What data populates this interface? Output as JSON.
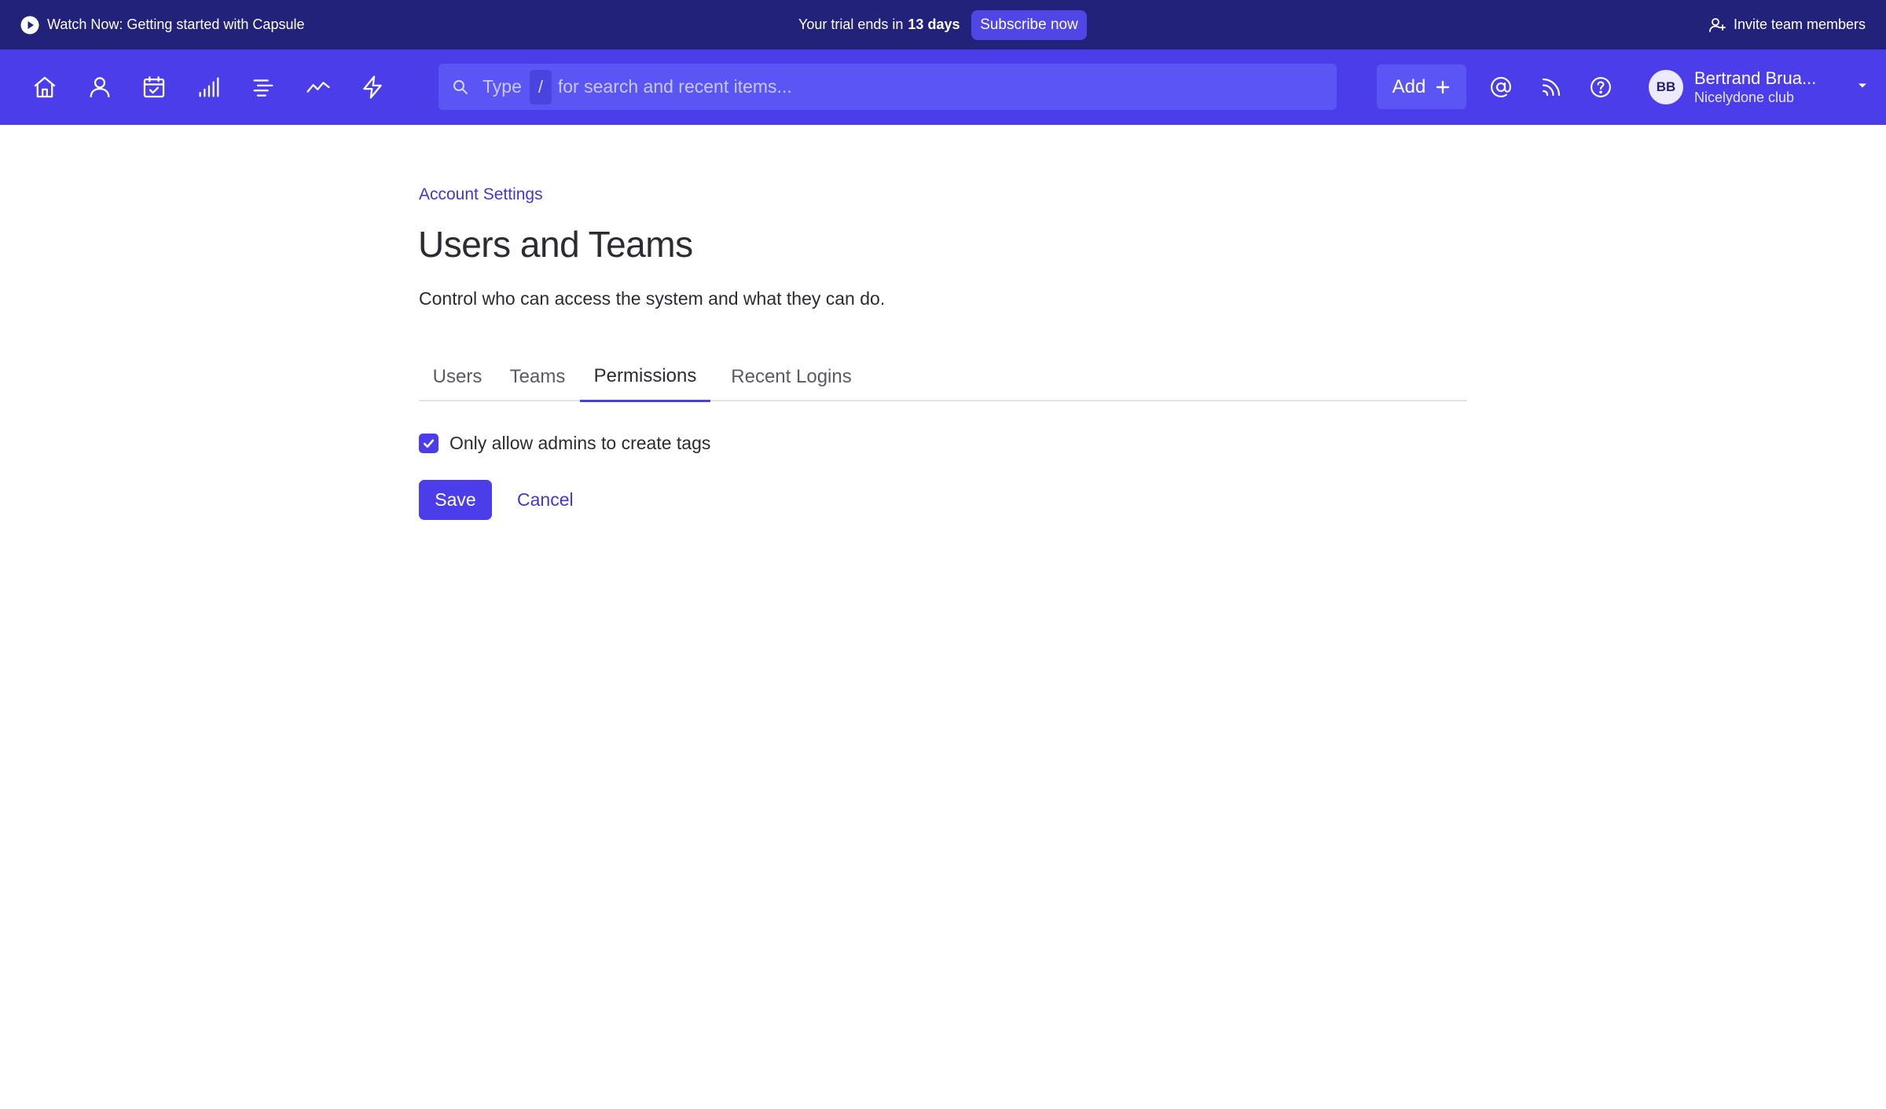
{
  "banner": {
    "watch_label": "Watch Now: Getting started with Capsule",
    "trial_prefix": "Your trial ends in",
    "trial_days": "13 days",
    "subscribe_label": "Subscribe now",
    "invite_label": "Invite team members"
  },
  "navbar": {
    "icons": [
      "home-icon",
      "person-icon",
      "calendar-check-icon",
      "bar-chart-icon",
      "list-icon",
      "activity-icon",
      "lightning-icon"
    ],
    "search": {
      "prefix": "Type",
      "shortcut": "/",
      "suffix": "for search and recent items..."
    },
    "add_label": "Add",
    "right_icons": [
      "at-sign-icon",
      "rss-feed-icon",
      "help-icon"
    ],
    "user": {
      "initials": "BB",
      "name": "Bertrand Brua...",
      "org": "Nicelydone club"
    }
  },
  "main": {
    "breadcrumb": "Account Settings",
    "title": "Users and Teams",
    "subtitle": "Control who can access the system and what they can do.",
    "tabs": [
      {
        "label": "Users",
        "active": false
      },
      {
        "label": "Teams",
        "active": false
      },
      {
        "label": "Permissions",
        "active": true
      },
      {
        "label": "Recent Logins",
        "active": false
      }
    ],
    "permission_option": {
      "label": "Only allow admins to create tags",
      "checked": true
    },
    "save_label": "Save",
    "cancel_label": "Cancel"
  },
  "colors": {
    "banner_bg": "#23227a",
    "navbar_bg": "#4b3eea",
    "accent": "#4b3eea",
    "link": "#4338ca"
  }
}
